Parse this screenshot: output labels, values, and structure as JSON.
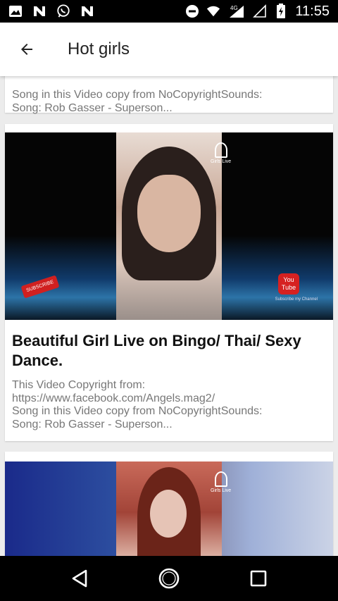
{
  "status_bar": {
    "time": "11:55",
    "network_label": "4G",
    "left_icons": [
      "image-icon",
      "news-n-icon",
      "whatsapp-icon",
      "news-n-icon"
    ],
    "right_icons": [
      "do-not-disturb-icon",
      "wifi-icon",
      "signal-icon",
      "signal-empty-icon",
      "battery-icon"
    ]
  },
  "app_bar": {
    "title": "Hot girls",
    "back_icon": "arrow-back-icon"
  },
  "cards": [
    {
      "description": "Song in this Video copy from NoCopyrightSounds:\nSong: Rob Gasser - Superson..."
    },
    {
      "title": "Beautiful Girl Live on Bingo/ Thai/ Sexy Dance.",
      "thumbnail_overlay": {
        "logo_text": "Girls Live",
        "subscribe_badge": "SUBSCRIBE",
        "youtube_badge": "You Tube",
        "caption": "Subscribe my Channel"
      },
      "description": "This Video Copyright from:\nhttps://www.facebook.com/Angels.mag2/\nSong in this Video copy from NoCopyrightSounds:\nSong: Rob Gasser - Superson..."
    },
    {
      "thumbnail_overlay": {
        "logo_text": "Girls Live"
      }
    }
  ],
  "nav_bar": {
    "buttons": [
      "back-triangle-icon",
      "home-circle-icon",
      "recents-square-icon"
    ]
  }
}
